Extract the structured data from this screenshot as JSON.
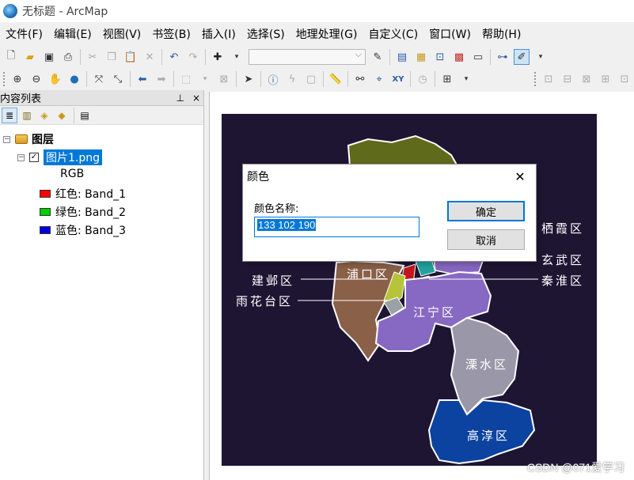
{
  "window": {
    "title": "无标题 - ArcMap"
  },
  "menu": [
    "文件(F)",
    "编辑(E)",
    "视图(V)",
    "书签(B)",
    "插入(I)",
    "选择(S)",
    "地理处理(G)",
    "自定义(C)",
    "窗口(W)",
    "帮助(H)"
  ],
  "toc": {
    "title": "内容列表",
    "pin": "ᵖ",
    "close": "×",
    "root_label": "图层",
    "layer_name": "图片1.png",
    "rgb_label": "RGB",
    "bands": [
      {
        "label": "红色:   Band_1",
        "color": "#ff0000"
      },
      {
        "label": "绿色: Band_2",
        "color": "#00d000"
      },
      {
        "label": "蓝色:   Band_3",
        "color": "#0000e0"
      }
    ]
  },
  "map": {
    "labels": {
      "qixia": "栖霞区",
      "xuanwu": "玄武区",
      "qinhuai": "秦淮区",
      "jianye": "建邺区",
      "yuhuatai": "雨花台区",
      "pukou": "浦口区",
      "jiangning": "江宁区",
      "lishui": "溧水区",
      "gaochun": "高淳区"
    },
    "colors": {
      "background": "#1e1533",
      "liuhe": "#5f6a1a",
      "pukou": "#8a6048",
      "jiangning": "#8768c2",
      "lishui": "#9a98a8",
      "gaochun": "#0c43a0"
    }
  },
  "dialog": {
    "title": "颜色",
    "field_label": "颜色名称:",
    "field_value": "133 102 190",
    "ok_label": "确定",
    "cancel_label": "取消"
  },
  "watermark": "CSDN @071爱学习"
}
